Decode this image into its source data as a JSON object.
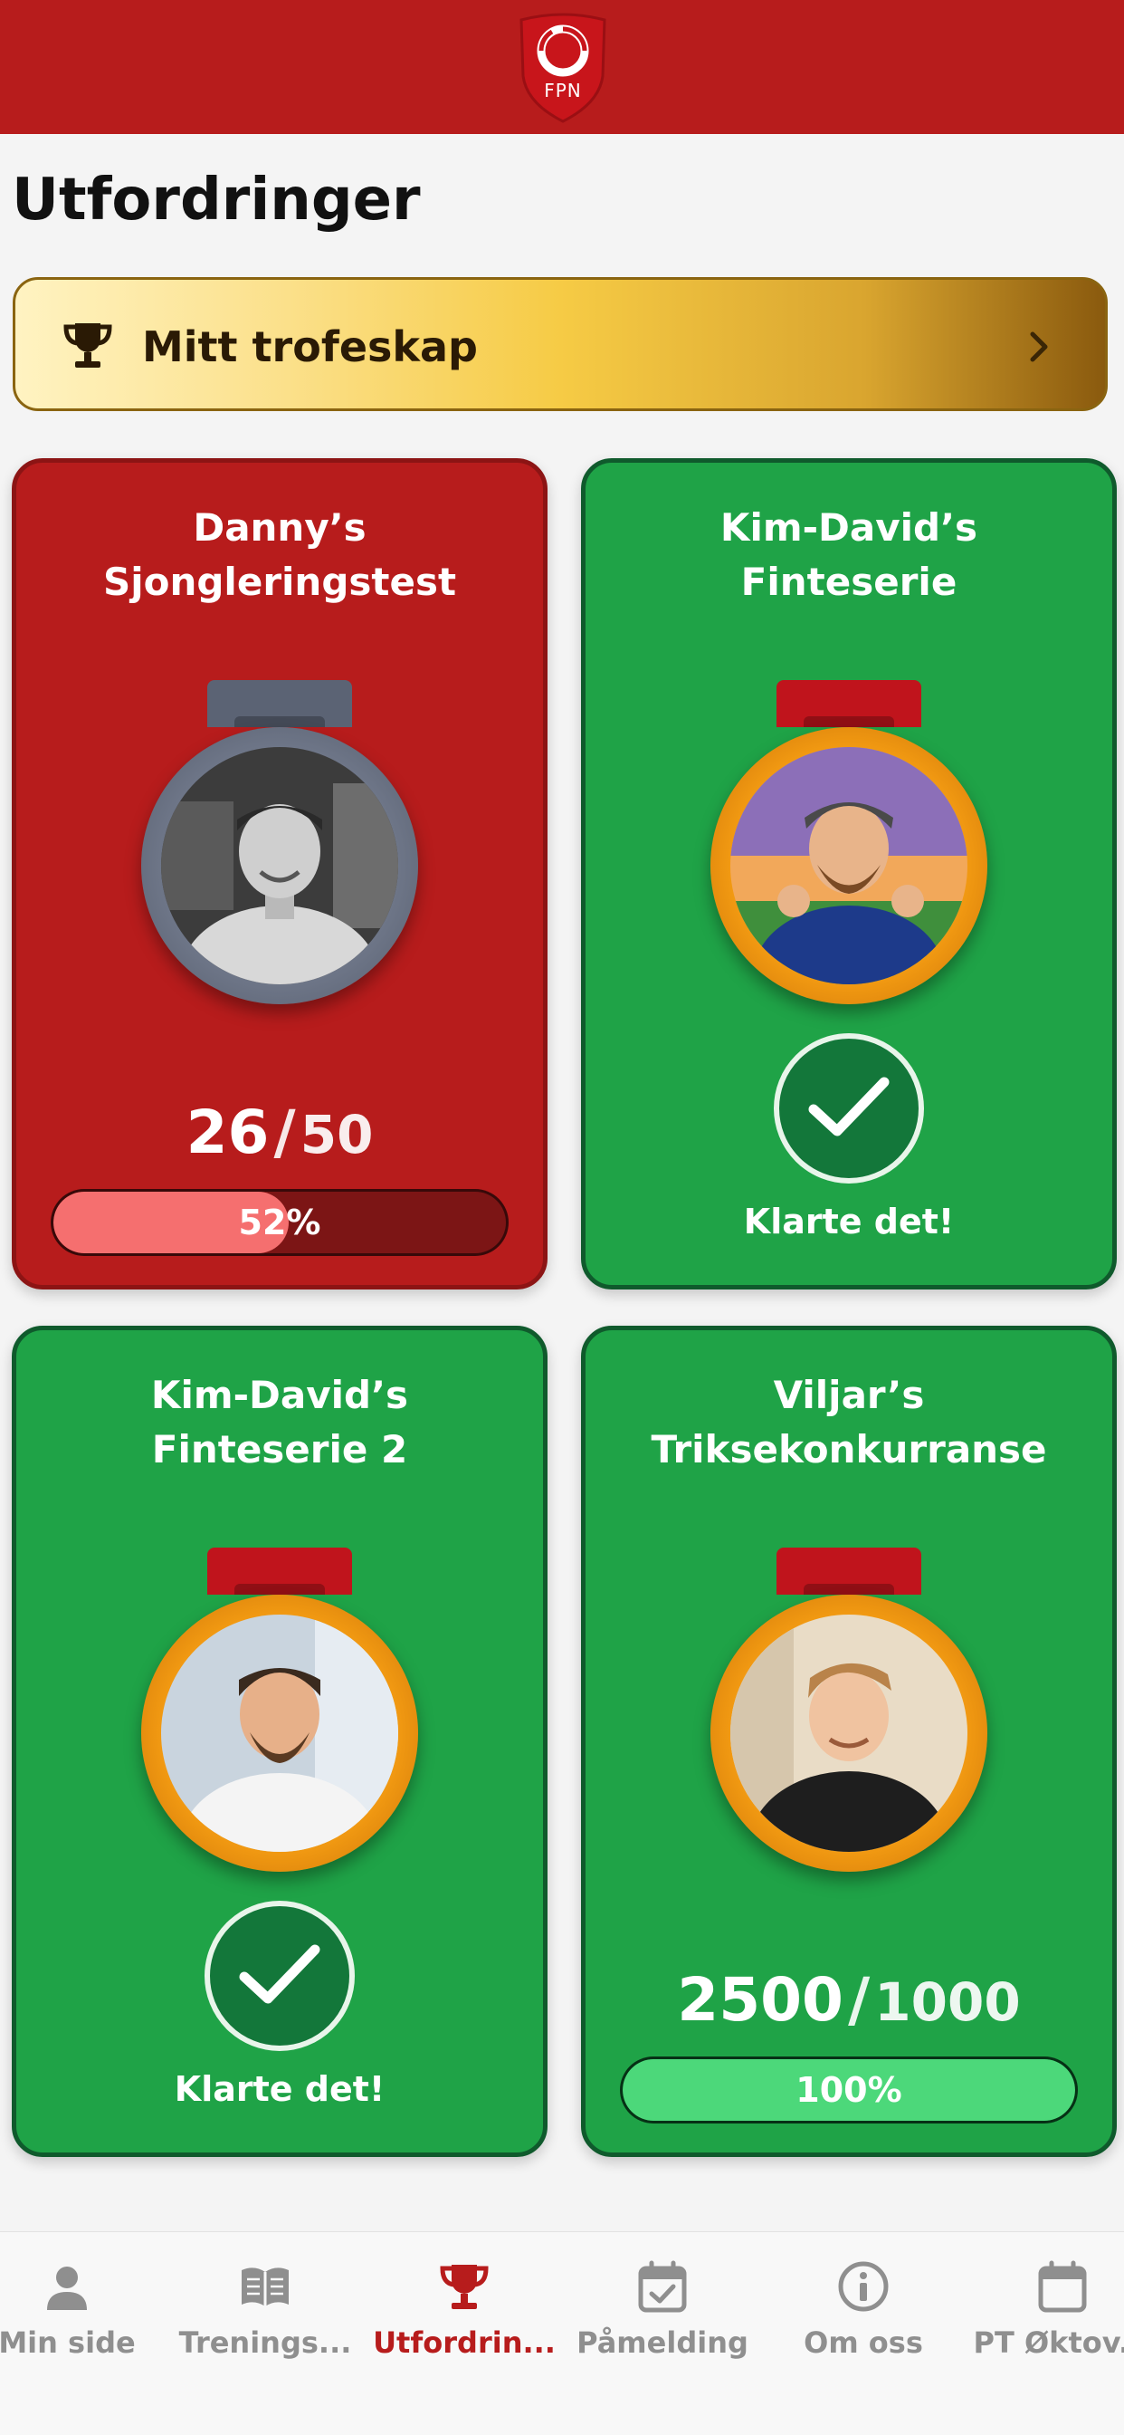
{
  "header": {
    "logo_text": "FPN"
  },
  "page": {
    "title": "Utfordringer"
  },
  "trophy_banner": {
    "label": "Mitt trofeskap"
  },
  "challenges": [
    {
      "title_line1": "Danny’s",
      "title_line2": "Sjongleringstest",
      "state": "in-progress",
      "score": "26",
      "separator": "/",
      "target": "50",
      "progress_percent": 52,
      "progress_label": "52%"
    },
    {
      "title_line1": "Kim-David’s",
      "title_line2": "Finteserie",
      "state": "completed",
      "completed_label": "Klarte det!"
    },
    {
      "title_line1": "Kim-David’s",
      "title_line2": "Finteserie 2",
      "state": "completed",
      "completed_label": "Klarte det!"
    },
    {
      "title_line1": "Viljar’s",
      "title_line2": "Triksekonkurranse",
      "state": "in-progress",
      "score": "2500",
      "separator": "/",
      "target": "1000",
      "progress_percent": 100,
      "progress_label": "100%"
    }
  ],
  "tabbar": {
    "items": [
      {
        "label": "Min side",
        "icon": "person-icon",
        "active": false
      },
      {
        "label": "Trenings...",
        "icon": "book-icon",
        "active": false
      },
      {
        "label": "Utfordrin...",
        "icon": "trophy-icon",
        "active": true
      },
      {
        "label": "Påmelding",
        "icon": "calendar-check-icon",
        "active": false
      },
      {
        "label": "Om oss",
        "icon": "info-icon",
        "active": false
      },
      {
        "label": "PT Øktov...",
        "icon": "calendar-icon",
        "active": false
      }
    ]
  },
  "colors": {
    "brand_red": "#b71c1c",
    "success_green": "#1fa347",
    "gold": "#f6cb45",
    "inactive_tab": "#8f8f8f"
  }
}
